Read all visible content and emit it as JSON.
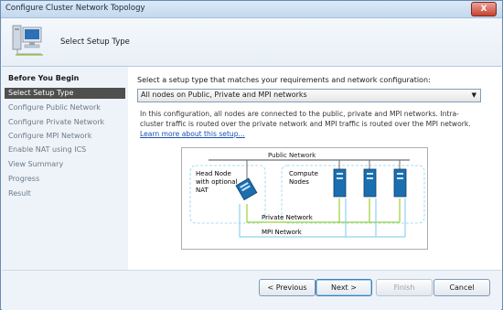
{
  "window": {
    "title": "Configure Cluster Network Topology",
    "close_label": "X"
  },
  "header": {
    "title": "Select Setup Type"
  },
  "nav": [
    {
      "label": "Before You Begin",
      "state": "bold"
    },
    {
      "label": "Select Setup Type",
      "state": "selected"
    },
    {
      "label": "Configure Public Network",
      "state": "normal"
    },
    {
      "label": "Configure Private Network",
      "state": "normal"
    },
    {
      "label": "Configure MPI Network",
      "state": "normal"
    },
    {
      "label": "Enable NAT using ICS",
      "state": "normal"
    },
    {
      "label": "View Summary",
      "state": "normal"
    },
    {
      "label": "Progress",
      "state": "normal"
    },
    {
      "label": "Result",
      "state": "normal"
    }
  ],
  "main": {
    "prompt": "Select a setup type that matches your requirements and network configuration:",
    "setup_type": {
      "selected": "All nodes on Public, Private and MPI networks"
    },
    "description": "In this configuration, all nodes are connected to the public, private and MPI networks. Intra-cluster traffic is routed over the private network and MPI traffic is routed over the MPI network.",
    "learn_more": "Learn more about this setup..."
  },
  "diagram": {
    "public_network": "Public Network",
    "head_node": [
      "Head Node",
      "with optional",
      "NAT"
    ],
    "compute_nodes": [
      "Compute",
      "Nodes"
    ],
    "private_network": "Private Network",
    "mpi_network": "MPI Network",
    "colors": {
      "public": "#6e6e6e",
      "private": "#9ad23a",
      "mpi": "#8fd3ee",
      "node": "#1b6fb0"
    }
  },
  "buttons": {
    "previous": {
      "label": "< Previous",
      "mnemonic": "P"
    },
    "next": {
      "label": "Next >",
      "mnemonic": "N"
    },
    "finish": {
      "label": "Finish",
      "mnemonic": "F"
    },
    "cancel": {
      "label": "Cancel"
    }
  }
}
